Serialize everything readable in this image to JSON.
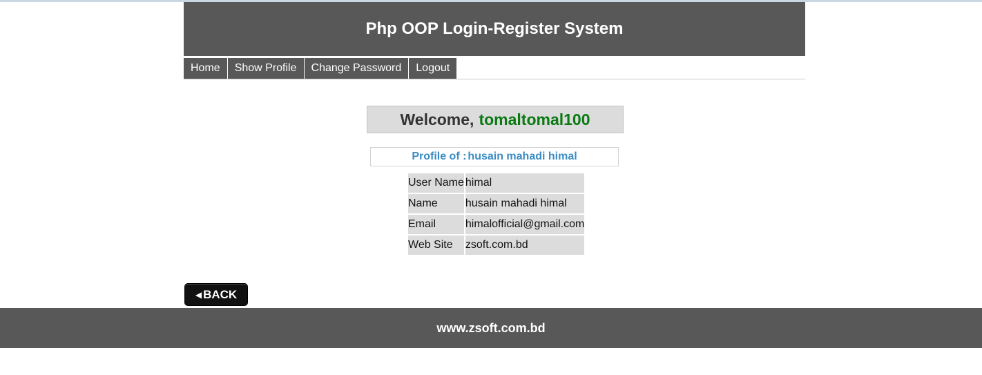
{
  "header": {
    "title": "Php OOP Login-Register System"
  },
  "nav": {
    "items": [
      {
        "label": "Home"
      },
      {
        "label": "Show Profile"
      },
      {
        "label": "Change Password"
      },
      {
        "label": "Logout"
      }
    ]
  },
  "welcome": {
    "prefix": "Welcome,",
    "username": "tomaltomal100"
  },
  "profile": {
    "title_prefix": "Profile of :",
    "title_name": "husain mahadi himal",
    "rows": [
      {
        "label": "User Name",
        "value": "himal"
      },
      {
        "label": "Name",
        "value": "husain mahadi himal"
      },
      {
        "label": "Email",
        "value": "himalofficial@gmail.com"
      },
      {
        "label": "Web Site",
        "value": "zsoft.com.bd"
      }
    ]
  },
  "back_button": {
    "arrow": "◀",
    "label": "BACK"
  },
  "footer": {
    "text": "www.zsoft.com.bd"
  },
  "colors": {
    "header_bg": "#585858",
    "username": "#0a7a12",
    "profile_title": "#3a8cc4",
    "table_cell": "#dcdcdc"
  }
}
